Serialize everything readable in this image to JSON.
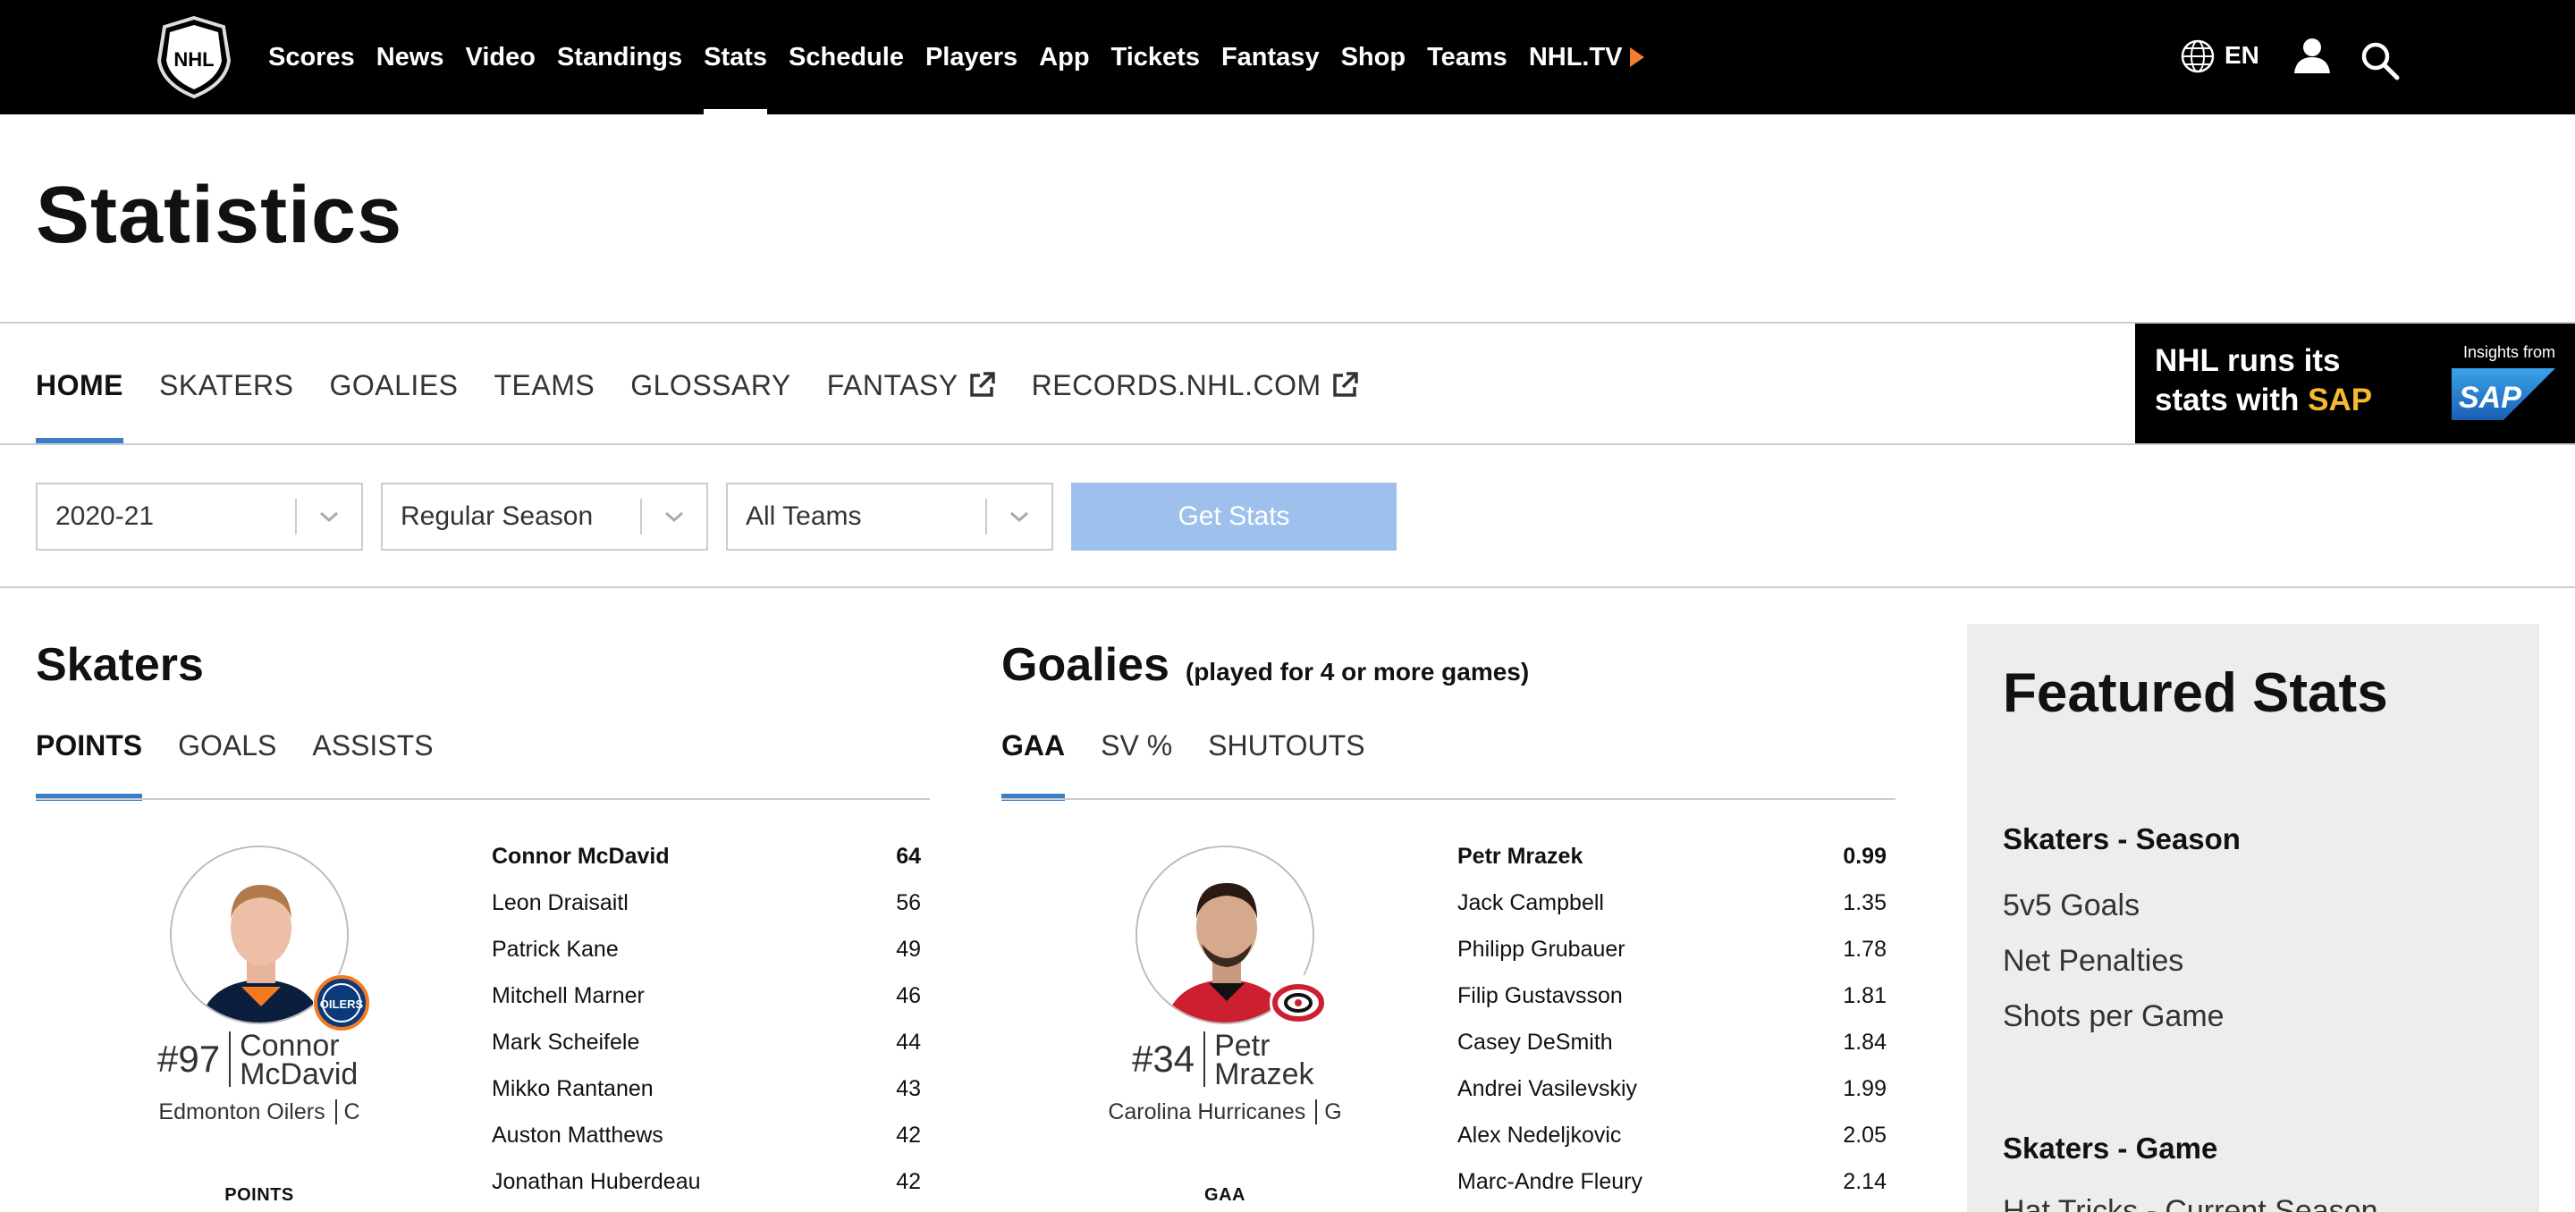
{
  "nav": {
    "items": [
      "Scores",
      "News",
      "Video",
      "Standings",
      "Stats",
      "Schedule",
      "Players",
      "App",
      "Tickets",
      "Fantasy",
      "Shop",
      "Teams",
      "NHL.TV"
    ],
    "active": "Stats",
    "lang": "EN"
  },
  "page": {
    "title": "Statistics"
  },
  "subnav": {
    "tabs": [
      "HOME",
      "SKATERS",
      "GOALIES",
      "TEAMS",
      "GLOSSARY",
      "FANTASY",
      "RECORDS.NHL.COM"
    ],
    "active": "HOME"
  },
  "ad": {
    "line1": "NHL runs its",
    "line2a": "stats with ",
    "line2b": "SAP",
    "insights": "Insights from",
    "logo_text": "SAP"
  },
  "filters": {
    "season": "2020-21",
    "game_type": "Regular Season",
    "team": "All Teams",
    "button": "Get Stats"
  },
  "skaters": {
    "heading": "Skaters",
    "tabs": [
      "POINTS",
      "GOALS",
      "ASSISTS"
    ],
    "active_tab": "POINTS",
    "featured": {
      "number": "#97",
      "first_name": "Connor",
      "last_name": "McDavid",
      "team": "Edmonton Oilers",
      "position": "C",
      "team_badge": "OILERS",
      "stat_label": "POINTS"
    },
    "leaders": [
      {
        "name": "Connor McDavid",
        "value": "64"
      },
      {
        "name": "Leon Draisaitl",
        "value": "56"
      },
      {
        "name": "Patrick Kane",
        "value": "49"
      },
      {
        "name": "Mitchell Marner",
        "value": "46"
      },
      {
        "name": "Mark Scheifele",
        "value": "44"
      },
      {
        "name": "Mikko Rantanen",
        "value": "43"
      },
      {
        "name": "Auston Matthews",
        "value": "42"
      },
      {
        "name": "Jonathan Huberdeau",
        "value": "42"
      }
    ]
  },
  "goalies": {
    "heading": "Goalies",
    "note": "(played for 4 or more games)",
    "tabs": [
      "GAA",
      "SV %",
      "SHUTOUTS"
    ],
    "active_tab": "GAA",
    "featured": {
      "number": "#34",
      "first_name": "Petr",
      "last_name": "Mrazek",
      "team": "Carolina Hurricanes",
      "position": "G",
      "stat_label": "GAA"
    },
    "leaders": [
      {
        "name": "Petr Mrazek",
        "value": "0.99"
      },
      {
        "name": "Jack Campbell",
        "value": "1.35"
      },
      {
        "name": "Philipp Grubauer",
        "value": "1.78"
      },
      {
        "name": "Filip Gustavsson",
        "value": "1.81"
      },
      {
        "name": "Casey DeSmith",
        "value": "1.84"
      },
      {
        "name": "Andrei Vasilevskiy",
        "value": "1.99"
      },
      {
        "name": "Alex Nedeljkovic",
        "value": "2.05"
      },
      {
        "name": "Marc-Andre Fleury",
        "value": "2.14"
      }
    ]
  },
  "featured_stats": {
    "title": "Featured Stats",
    "season_heading": "Skaters - Season",
    "season_items": [
      "5v5 Goals",
      "Net Penalties",
      "Shots per Game"
    ],
    "game_heading": "Skaters - Game",
    "game_items": [
      "Hat Tricks - Current Season"
    ]
  },
  "colors": {
    "accent": "#3a7dc9",
    "nav_bg": "#000000",
    "button_disabled": "#9dc1ec",
    "sap_yellow": "#f5b82e",
    "nhltv_orange": "#f47d30",
    "featured_bg": "#ededed"
  }
}
